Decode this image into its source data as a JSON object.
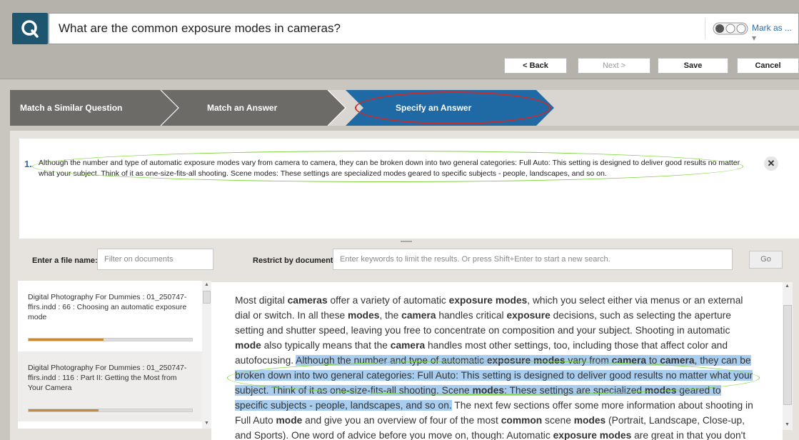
{
  "header": {
    "question": "What are the common exposure modes in cameras?",
    "mark_as": "Mark as ...",
    "mark_arrow": "▾",
    "logo_glyph": "Q"
  },
  "toolbar": {
    "back": "< Back",
    "next": "Next >",
    "save": "Save",
    "cancel": "Cancel"
  },
  "steps": [
    {
      "label": "Match a Similar Question",
      "state": "done"
    },
    {
      "label": "Match an Answer",
      "state": "done"
    },
    {
      "label": "Specify an Answer",
      "state": "active"
    }
  ],
  "answer": {
    "number": "1.",
    "text": "Although the number and type of automatic exposure modes vary from camera to camera, they can be broken down into two general categories: Full Auto: This setting is designed to deliver good results no matter what your subject. Think of it as one-size-fits-all shooting. Scene modes: These settings are specialized modes geared to specific subjects - people, landscapes, and so on.",
    "close_glyph": "✕"
  },
  "filters": {
    "file_label": "Enter a file name:",
    "file_placeholder": "Filter on documents",
    "restrict_label": "Restrict by document:",
    "restrict_placeholder": "Enter keywords to limit the results. Or press Shift+Enter to start a new search.",
    "go": "Go"
  },
  "results": [
    {
      "title": "Digital Photography For Dummies : 01_250747-ffirs.indd : 66 : Choosing an automatic exposure mode",
      "relevance": 0.46
    },
    {
      "title": "Digital Photography For Dummies : 01_250747-ffirs.indd : 116 : Part II: Getting the Most from Your Camera",
      "relevance": 0.43
    }
  ],
  "document": {
    "segments": [
      {
        "t": "Most digital ",
        "b": false,
        "h": false
      },
      {
        "t": "cameras",
        "b": true,
        "h": false
      },
      {
        "t": " offer a variety of automatic ",
        "b": false,
        "h": false
      },
      {
        "t": "exposure modes",
        "b": true,
        "h": false
      },
      {
        "t": ", which you select either via menus or an external dial or switch. In all these ",
        "b": false,
        "h": false
      },
      {
        "t": "modes",
        "b": true,
        "h": false
      },
      {
        "t": ", the ",
        "b": false,
        "h": false
      },
      {
        "t": "camera",
        "b": true,
        "h": false
      },
      {
        "t": " handles critical ",
        "b": false,
        "h": false
      },
      {
        "t": "exposure",
        "b": true,
        "h": false
      },
      {
        "t": " decisions, such as selecting the aperture setting and shutter speed, leaving you free to concentrate on composition and your subject. Shooting in automatic ",
        "b": false,
        "h": false
      },
      {
        "t": "mode",
        "b": true,
        "h": false
      },
      {
        "t": " also typically means that the ",
        "b": false,
        "h": false
      },
      {
        "t": "camera",
        "b": true,
        "h": false
      },
      {
        "t": " handles most other settings, too, including those that affect color and autofocusing. ",
        "b": false,
        "h": false
      },
      {
        "t": "Although the number and type of automatic ",
        "b": false,
        "h": true
      },
      {
        "t": "exposure modes",
        "b": true,
        "h": true
      },
      {
        "t": " vary from ",
        "b": false,
        "h": true
      },
      {
        "t": "camera",
        "b": true,
        "h": true
      },
      {
        "t": " to ",
        "b": false,
        "h": true
      },
      {
        "t": "camera",
        "b": true,
        "h": true
      },
      {
        "t": ", they can be broken down into two general categories: Full Auto: This setting is designed to deliver good results no matter what your subject. Think of it as one-size-fits-all shooting. Scene ",
        "b": false,
        "h": true
      },
      {
        "t": "modes",
        "b": true,
        "h": true
      },
      {
        "t": ": These settings are specialized ",
        "b": false,
        "h": true
      },
      {
        "t": "modes",
        "b": true,
        "h": true
      },
      {
        "t": " geared to specific subjects - people, landscapes, and so on.",
        "b": false,
        "h": true
      },
      {
        "t": " The next few sections offer some more information about shooting in Full Auto ",
        "b": false,
        "h": false
      },
      {
        "t": "mode",
        "b": true,
        "h": false
      },
      {
        "t": " and give you an overview of four of the most ",
        "b": false,
        "h": false
      },
      {
        "t": "common",
        "b": true,
        "h": false
      },
      {
        "t": " scene ",
        "b": false,
        "h": false
      },
      {
        "t": "modes",
        "b": true,
        "h": false
      },
      {
        "t": " (Portrait, Landscape, Close-up, and Sports). One word of advice before you move on, though: Automatic ",
        "b": false,
        "h": false
      },
      {
        "t": "exposure modes",
        "b": true,
        "h": false
      },
      {
        "t": " are great in that you don't have to know much about photography or have",
        "b": false,
        "h": false
      }
    ]
  },
  "colors": {
    "accent": "#1f6aa5",
    "step_done": "#6d6b67",
    "annotation_red": "#cc2b2b",
    "annotation_green": "#7fd43a",
    "highlight": "#a9cdef",
    "progress": "#c98a35"
  }
}
